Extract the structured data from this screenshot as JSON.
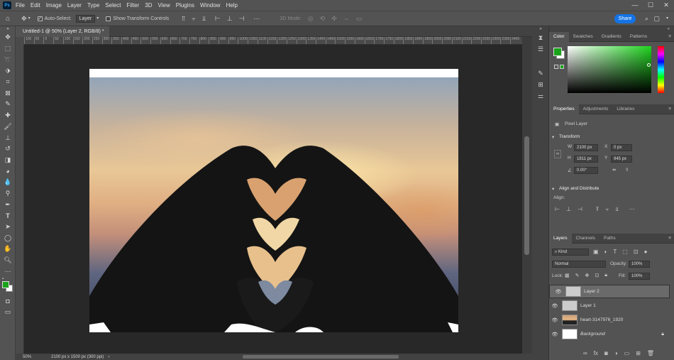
{
  "app": {
    "logo": "Ps"
  },
  "menu": [
    "File",
    "Edit",
    "Image",
    "Layer",
    "Type",
    "Select",
    "Filter",
    "3D",
    "View",
    "Plugins",
    "Window",
    "Help"
  ],
  "window_controls": {
    "min": "—",
    "max": "☐",
    "close": "✕"
  },
  "options_bar": {
    "auto_select_label": "Auto-Select:",
    "auto_select_value": "Layer",
    "show_transform_label": "Show Transform Controls",
    "mode_3d_label": "3D Mode:",
    "share_label": "Share"
  },
  "document": {
    "tab_title": "Untitled-1 @ 50% (Layer 2, RGB/8) *",
    "tab_close": "✕",
    "zoom": "50%",
    "doc_info": "2100 px x 1500 px (300 ppi)"
  },
  "ruler_ticks": [
    "100",
    "50",
    "0",
    "50",
    "100",
    "150",
    "200",
    "250",
    "300",
    "350",
    "400",
    "450",
    "500",
    "550",
    "600",
    "650",
    "700",
    "750",
    "800",
    "850",
    "900",
    "950",
    "1000",
    "1050",
    "1100",
    "1150",
    "1200",
    "1250",
    "1300",
    "1350",
    "1400",
    "1450",
    "1500",
    "1550",
    "1600",
    "1650",
    "1700",
    "1750",
    "1800",
    "1850",
    "1900",
    "1950",
    "2000",
    "2050",
    "2100",
    "2150",
    "2200",
    "2250",
    "2300",
    "2350",
    "2400"
  ],
  "color_panel": {
    "tabs": [
      "Color",
      "Swatches",
      "Gradients",
      "Patterns"
    ],
    "active_tab": "Color",
    "foreground": "#1aa31a",
    "background": "#ffffff"
  },
  "properties_panel": {
    "tabs": [
      "Properties",
      "Adjustments",
      "Libraries"
    ],
    "active_tab": "Properties",
    "layer_type": "Pixel Layer",
    "transform_title": "Transform",
    "w_label": "W",
    "w_value": "2100 px",
    "h_label": "H",
    "h_value": "1811 px",
    "x_label": "X",
    "x_value": "0 px",
    "y_label": "Y",
    "y_value": "945 px",
    "angle_value": "0.00°",
    "align_title": "Align and Distribute",
    "align_label": "Align:"
  },
  "layers_panel": {
    "tabs": [
      "Layers",
      "Channels",
      "Paths"
    ],
    "active_tab": "Layers",
    "filter_kind": "Kind",
    "blend_mode": "Normal",
    "opacity_label": "Opacity:",
    "opacity_value": "100%",
    "lock_label": "Lock:",
    "fill_label": "Fill:",
    "fill_value": "100%",
    "layers": [
      {
        "name": "Layer 2",
        "selected": true,
        "visible": true
      },
      {
        "name": "Layer 1",
        "selected": false,
        "visible": true
      },
      {
        "name": "heart-3147976_1920",
        "selected": false,
        "visible": true
      },
      {
        "name": "Background",
        "selected": false,
        "visible": true,
        "locked": true
      }
    ]
  },
  "colors": {
    "accent": "#1473e6",
    "panel": "#535353",
    "canvas": "#282828"
  }
}
